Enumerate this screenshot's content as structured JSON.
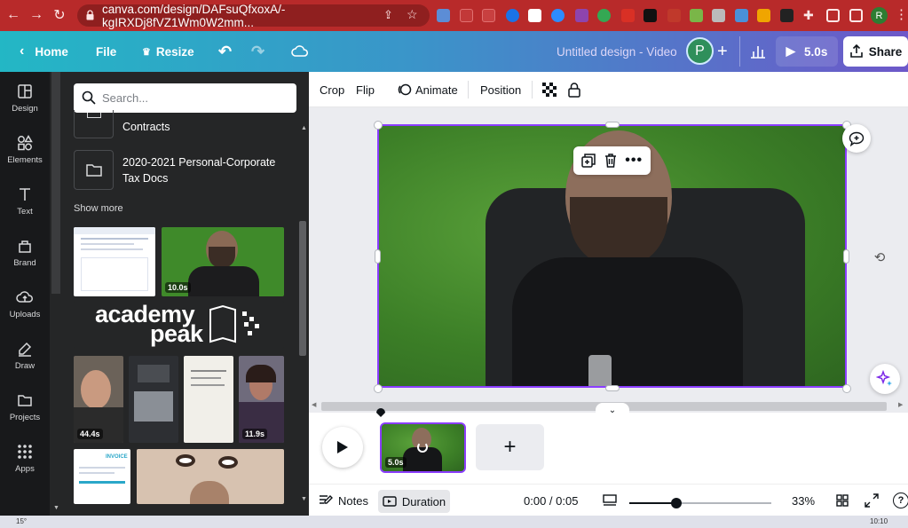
{
  "browser": {
    "url": "canva.com/design/DAFsuQfxoxA/-kgIRXDj8fVZ1Wm0W2mm...",
    "profile_initial": "R",
    "time": "10:10",
    "temp": "15°"
  },
  "topbar": {
    "home": "Home",
    "file": "File",
    "resize": "Resize",
    "design_title": "Untitled design - Video",
    "collaborator_initial": "P",
    "play_duration": "5.0s",
    "share": "Share"
  },
  "rail": {
    "items": [
      {
        "label": "Design",
        "icon": "design-icon"
      },
      {
        "label": "Elements",
        "icon": "elements-icon"
      },
      {
        "label": "Text",
        "icon": "text-icon"
      },
      {
        "label": "Brand",
        "icon": "brand-icon"
      },
      {
        "label": "Uploads",
        "icon": "uploads-icon"
      },
      {
        "label": "Draw",
        "icon": "draw-icon"
      },
      {
        "label": "Projects",
        "icon": "projects-icon"
      },
      {
        "label": "Apps",
        "icon": "apps-icon"
      }
    ]
  },
  "panel": {
    "search_placeholder": "Search...",
    "folders": [
      {
        "name": "Contracts"
      },
      {
        "name": "2020-2021 Personal-Corporate Tax Docs"
      }
    ],
    "show_more": "Show more",
    "thumbs": {
      "video1_duration": "10.0s",
      "logo_text_1": "academy",
      "logo_text_2": "peak",
      "video2_duration": "44.4s",
      "video3_duration": "11.9s",
      "invoice_text": "INVOICE"
    }
  },
  "toolbar": {
    "crop": "Crop",
    "flip": "Flip",
    "animate": "Animate",
    "position": "Position"
  },
  "timeline": {
    "clip_duration": "5.0s"
  },
  "footer": {
    "notes": "Notes",
    "duration": "Duration",
    "time": "0:00 / 0:05",
    "zoom": "33%",
    "zoom_level": 0.33
  },
  "colors": {
    "accent": "#8b3dff",
    "browser": "#b82a2a",
    "panel": "#252627",
    "rail": "#18191b"
  }
}
